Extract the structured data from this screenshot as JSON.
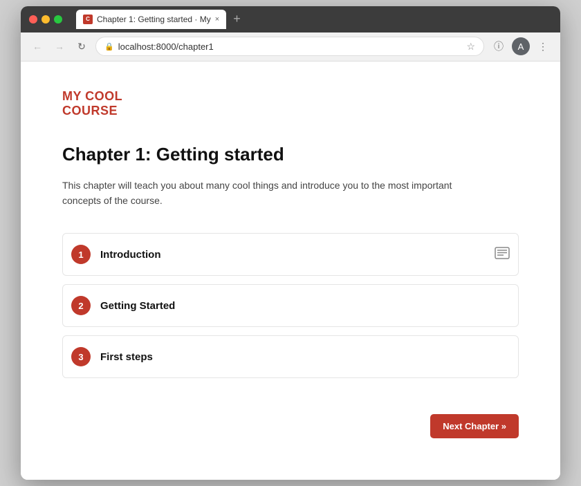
{
  "browser": {
    "tab_title": "Chapter 1: Getting started · My",
    "tab_close": "×",
    "tab_new": "+",
    "address": "localhost:8000/chapter1",
    "favicon_label": "C"
  },
  "site": {
    "logo_line1": "MY COOL",
    "logo_line2": "COURSE"
  },
  "page": {
    "title": "Chapter 1: Getting started",
    "description": "This chapter will teach you about many cool things and introduce you to the most important concepts of the course.",
    "lessons": [
      {
        "number": "1",
        "name": "Introduction",
        "has_icon": true
      },
      {
        "number": "2",
        "name": "Getting Started",
        "has_icon": false
      },
      {
        "number": "3",
        "name": "First steps",
        "has_icon": false
      }
    ],
    "next_button_label": "Next Chapter »"
  },
  "icons": {
    "back": "←",
    "forward": "→",
    "reload": "↻",
    "star": "☆",
    "info": "ⓘ",
    "account": "A",
    "menu": "⋮",
    "lock": "🔒",
    "article": "☰"
  },
  "colors": {
    "brand_red": "#c0392b",
    "tab_bg": "#ffffff",
    "titlebar_bg": "#3c3c3c"
  }
}
